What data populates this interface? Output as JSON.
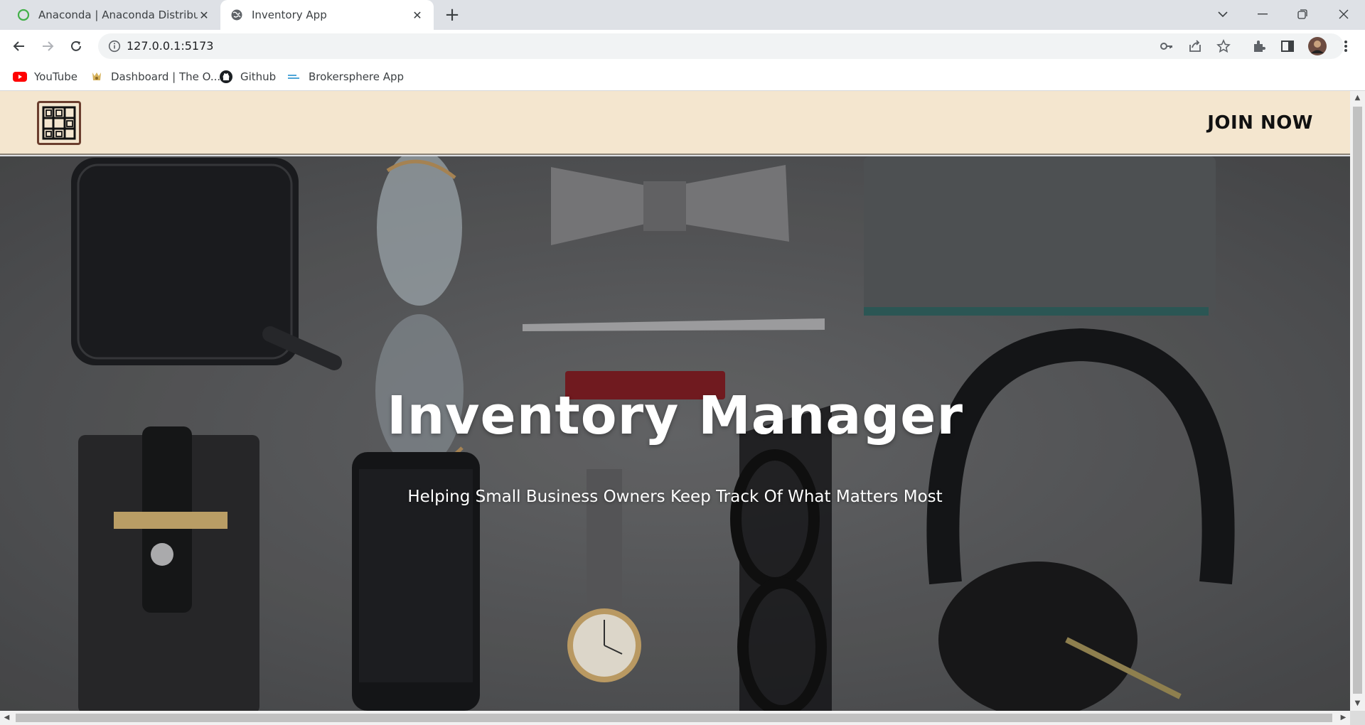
{
  "browser": {
    "tabs": [
      {
        "title": "Anaconda | Anaconda Distributio",
        "icon": "anaconda-ring-icon",
        "active": false
      },
      {
        "title": "Inventory App",
        "icon": "globe-icon",
        "active": true
      }
    ],
    "new_tab_label": "+",
    "window_controls": [
      "tab-search-icon",
      "minimize-icon",
      "restore-icon",
      "close-icon"
    ],
    "url": "127.0.0.1:5173",
    "bookmarks": [
      {
        "label": "YouTube",
        "icon": "youtube-icon"
      },
      {
        "label": "Dashboard | The O...",
        "icon": "odin-icon"
      },
      {
        "label": "Github",
        "icon": "github-icon"
      },
      {
        "label": "Brokersphere App",
        "icon": "brokersphere-icon"
      }
    ]
  },
  "page": {
    "nav": {
      "logo": "warehouse-shelves-icon",
      "cta": "JOIN NOW"
    },
    "hero": {
      "title": "Inventory Manager",
      "subtitle": "Helping Small Business Owners Keep Track Of What Matters Most"
    }
  },
  "colors": {
    "nav_bg": "#f4e6cf",
    "logo_border": "#6b3e2e",
    "hero_bg": "#5c5d5f",
    "hero_text": "#ffffff"
  }
}
